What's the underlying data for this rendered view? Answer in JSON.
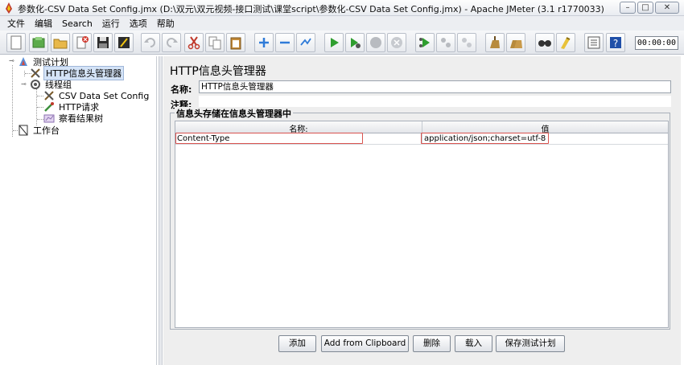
{
  "window": {
    "title": "参数化-CSV Data Set Config.jmx (D:\\双元\\双元视频-接口测试\\课堂script\\参数化-CSV Data Set Config.jmx) - Apache JMeter (3.1 r1770033)",
    "minimize": "–",
    "maximize": "□",
    "close": "✕"
  },
  "menu": [
    "文件",
    "编辑",
    "Search",
    "运行",
    "选项",
    "帮助"
  ],
  "toolbar": {
    "timer": "00:00:00",
    "icons": [
      "new-icon",
      "templates-icon",
      "open-icon",
      "close-icon",
      "save-icon",
      "save-as-icon",
      "undo-icon",
      "redo-icon",
      "cut-icon",
      "copy-icon",
      "paste-icon",
      "expand-icon",
      "collapse-icon",
      "toggle-icon",
      "start-icon",
      "start-no-pause-icon",
      "stop-icon",
      "shutdown-icon",
      "remote-start-icon",
      "remote-stop-icon",
      "remote-exit-icon",
      "clear-icon",
      "clear-all-icon",
      "search-icon",
      "reset-search-icon",
      "function-helper-icon",
      "help-icon"
    ]
  },
  "tree": {
    "items": [
      {
        "label": "测试计划",
        "icon": "test-plan-icon"
      },
      {
        "label": "HTTP信息头管理器",
        "icon": "header-manager-icon"
      },
      {
        "label": "线程组",
        "icon": "thread-group-icon"
      },
      {
        "label": "CSV Data Set Config",
        "icon": "csv-config-icon"
      },
      {
        "label": "HTTP请求",
        "icon": "http-sampler-icon"
      },
      {
        "label": "察看结果树",
        "icon": "results-tree-icon"
      },
      {
        "label": "工作台",
        "icon": "workbench-icon"
      }
    ]
  },
  "panel": {
    "title": "HTTP信息头管理器",
    "name_label": "名称:",
    "name_value": "HTTP信息头管理器",
    "comment_label": "注释:",
    "group_title": "信息头存储在信息头管理器中",
    "table": {
      "columns": [
        "名称:",
        "值"
      ],
      "rows": [
        {
          "name": "Content-Type",
          "value": "application/json;charset=utf-8"
        }
      ]
    },
    "buttons": {
      "add": "添加",
      "add_clipboard": "Add from Clipboard",
      "delete": "删除",
      "load": "载入",
      "save": "保存测试计划"
    }
  },
  "colors": {
    "highlight": "#d9534f",
    "selection": "#d4e3f7"
  }
}
